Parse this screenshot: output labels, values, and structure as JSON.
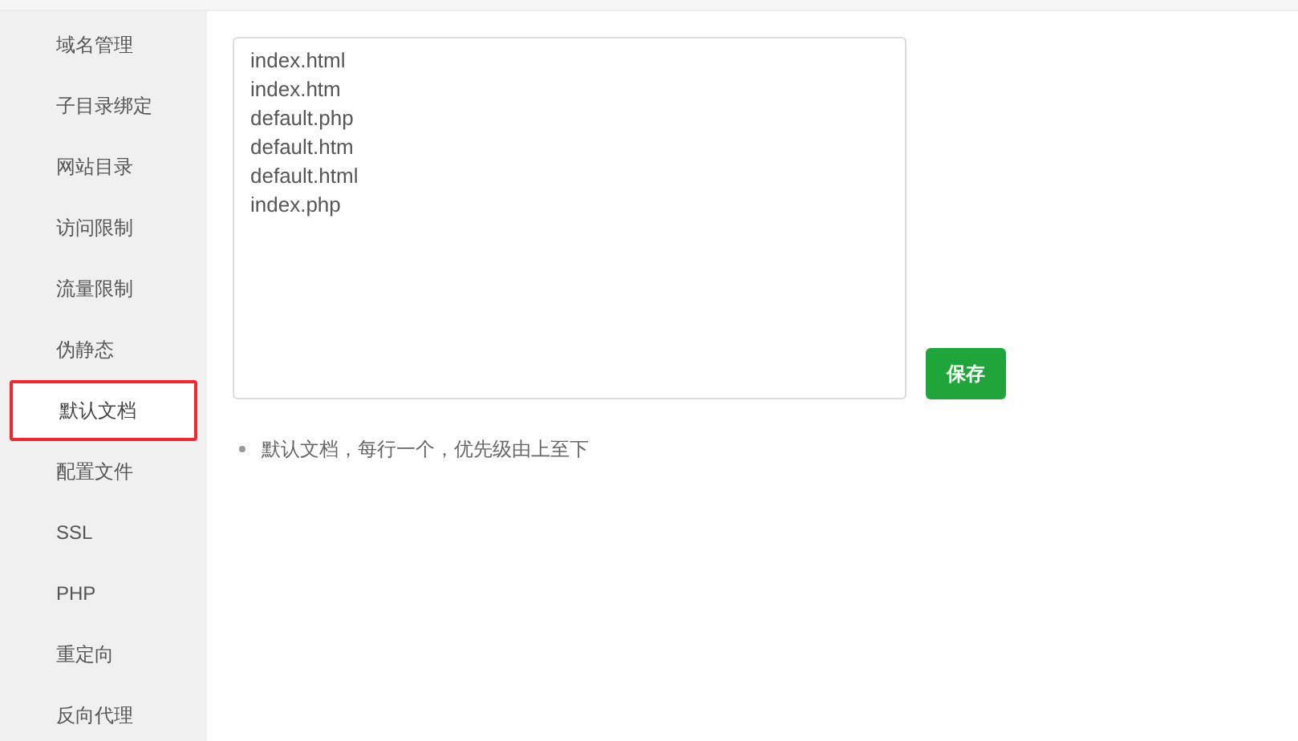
{
  "sidebar": {
    "items": [
      {
        "label": "域名管理",
        "selected": false
      },
      {
        "label": "子目录绑定",
        "selected": false
      },
      {
        "label": "网站目录",
        "selected": false
      },
      {
        "label": "访问限制",
        "selected": false
      },
      {
        "label": "流量限制",
        "selected": false
      },
      {
        "label": "伪静态",
        "selected": false
      },
      {
        "label": "默认文档",
        "selected": true
      },
      {
        "label": "配置文件",
        "selected": false
      },
      {
        "label": "SSL",
        "selected": false
      },
      {
        "label": "PHP",
        "selected": false
      },
      {
        "label": "重定向",
        "selected": false
      },
      {
        "label": "反向代理",
        "selected": false
      }
    ]
  },
  "editor": {
    "value": "index.html\nindex.htm\ndefault.php\ndefault.htm\ndefault.html\nindex.php"
  },
  "save_button": "保存",
  "tips": [
    "默认文档，每行一个，优先级由上至下"
  ]
}
